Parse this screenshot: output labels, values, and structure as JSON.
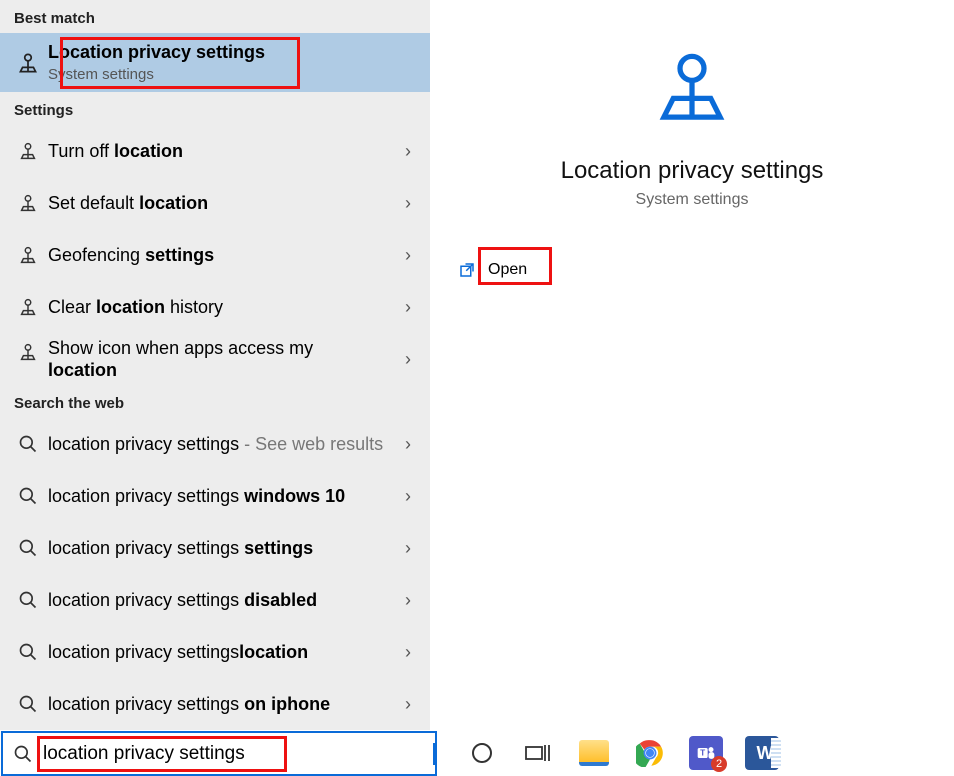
{
  "left": {
    "section_best": "Best match",
    "best_match": {
      "title": "Location privacy settings",
      "subtitle": "System settings"
    },
    "section_settings": "Settings",
    "settings_items": [
      {
        "pre": "Turn off ",
        "bold": "location",
        "post": ""
      },
      {
        "pre": "Set default ",
        "bold": "location",
        "post": ""
      },
      {
        "pre": "Geofencing ",
        "bold": "settings",
        "post": ""
      },
      {
        "pre": "Clear ",
        "bold": "location",
        "post": " history"
      },
      {
        "pre": "Show icon when apps access my ",
        "bold": "location",
        "post": ""
      }
    ],
    "section_web": "Search the web",
    "web_items": [
      {
        "text": "location privacy settings",
        "bold": "",
        "hint": " - See web results"
      },
      {
        "text": "location privacy settings ",
        "bold": "windows 10",
        "hint": ""
      },
      {
        "text": "location privacy settings ",
        "bold": "settings",
        "hint": ""
      },
      {
        "text": "location privacy settings ",
        "bold": "disabled",
        "hint": ""
      },
      {
        "text": "location privacy settings",
        "bold": "location",
        "hint": ""
      },
      {
        "text": "location privacy settings ",
        "bold": "on iphone",
        "hint": ""
      }
    ]
  },
  "right": {
    "title": "Location privacy settings",
    "subtitle": "System settings",
    "actions": [
      {
        "label": "Open"
      }
    ]
  },
  "search": {
    "value": "location privacy settings"
  },
  "taskbar": {
    "teams_badge": "2"
  },
  "colors": {
    "accent": "#0a6bd8",
    "highlight": "#e11",
    "selection": "#afcbe4"
  }
}
